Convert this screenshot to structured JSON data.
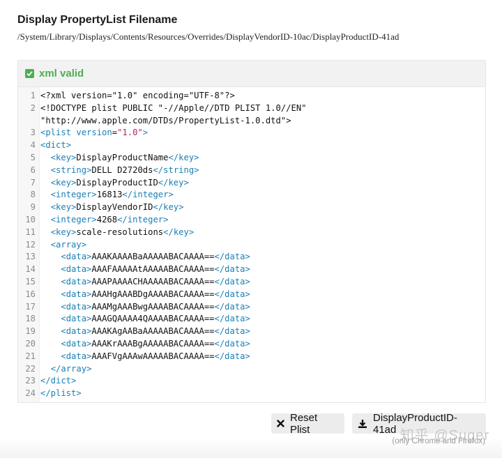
{
  "header": {
    "title": "Display PropertyList Filename",
    "path": "/System/Library/Displays/Contents/Resources/Overrides/DisplayVendorID-10ac/DisplayProductID-41ad"
  },
  "status": {
    "label": "xml valid",
    "color": "#4caf50",
    "icon": "check-square-icon"
  },
  "editor": {
    "lines": [
      {
        "n": "1",
        "text": "<?xml version=\"1.0\" encoding=\"UTF-8\"?>"
      },
      {
        "n": "2",
        "text": "<!DOCTYPE plist PUBLIC \"-//Apple//DTD PLIST 1.0//EN\""
      },
      {
        "n": "",
        "text": "\"http://www.apple.com/DTDs/PropertyList-1.0.dtd\">"
      },
      {
        "n": "3",
        "text": "<plist version=\"1.0\">"
      },
      {
        "n": "4",
        "text": "<dict>"
      },
      {
        "n": "5",
        "text": "  <key>DisplayProductName</key>"
      },
      {
        "n": "6",
        "text": "  <string>DELL D2720ds</string>"
      },
      {
        "n": "7",
        "text": "  <key>DisplayProductID</key>"
      },
      {
        "n": "8",
        "text": "  <integer>16813</integer>"
      },
      {
        "n": "9",
        "text": "  <key>DisplayVendorID</key>"
      },
      {
        "n": "10",
        "text": "  <integer>4268</integer>"
      },
      {
        "n": "11",
        "text": "  <key>scale-resolutions</key>"
      },
      {
        "n": "12",
        "text": "  <array>"
      },
      {
        "n": "13",
        "text": "    <data>AAAKAAAABaAAAAABACAAAA==</data>"
      },
      {
        "n": "14",
        "text": "    <data>AAAFAAAAAtAAAAABACAAAA==</data>"
      },
      {
        "n": "15",
        "text": "    <data>AAAPAAAACHAAAAABACAAAA==</data>"
      },
      {
        "n": "16",
        "text": "    <data>AAAHgAAABDgAAAABACAAAA==</data>"
      },
      {
        "n": "17",
        "text": "    <data>AAAMgAAABwgAAAABACAAAA==</data>"
      },
      {
        "n": "18",
        "text": "    <data>AAAGQAAAA4QAAAABACAAAA==</data>"
      },
      {
        "n": "19",
        "text": "    <data>AAAKAgAABaAAAAABACAAAA==</data>"
      },
      {
        "n": "20",
        "text": "    <data>AAAKrAAABgAAAAABACAAAA==</data>"
      },
      {
        "n": "21",
        "text": "    <data>AAAFVgAAAwAAAAABACAAAA==</data>"
      },
      {
        "n": "22",
        "text": "  </array>"
      },
      {
        "n": "23",
        "text": "</dict>"
      },
      {
        "n": "24",
        "text": "</plist>"
      }
    ]
  },
  "actions": {
    "reset_label": "Reset Plist",
    "reset_icon": "close-icon",
    "download_label": "DisplayProductID-41ad",
    "download_icon": "download-icon",
    "note": "(only Chrome and Firefox)"
  },
  "watermark": "知乎 @Suger"
}
